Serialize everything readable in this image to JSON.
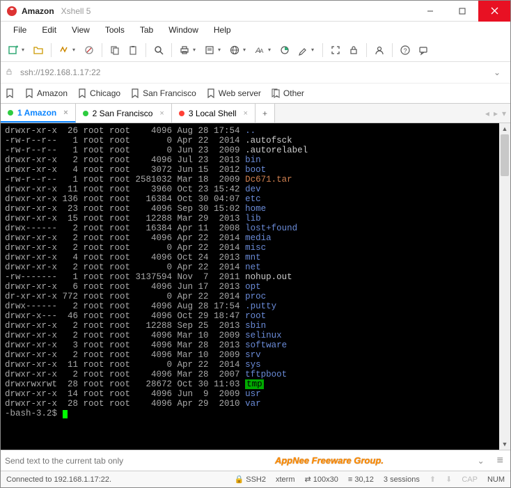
{
  "window": {
    "title": "Amazon",
    "subtitle": "Xshell 5"
  },
  "menu": [
    "File",
    "Edit",
    "View",
    "Tools",
    "Tab",
    "Window",
    "Help"
  ],
  "address": "ssh://192.168.1.17:22",
  "bookmarks": [
    {
      "label": "Amazon"
    },
    {
      "label": "Chicago"
    },
    {
      "label": "San Francisco"
    },
    {
      "label": "Web server"
    },
    {
      "label": "Other",
      "multi": true
    }
  ],
  "tabs": [
    {
      "label": "1 Amazon",
      "dot": "#2ecc40",
      "active": true
    },
    {
      "label": "2 San Francisco",
      "dot": "#2ecc40"
    },
    {
      "label": "3 Local Shell",
      "dot": "#ff4136"
    }
  ],
  "send_placeholder": "Send text to the current tab only",
  "watermark": "AppNee Freeware Group.",
  "status": {
    "conn": "Connected to 192.168.1.17:22.",
    "proto": "SSH2",
    "term": "xterm",
    "size": "100x30",
    "cursor": "30,12",
    "sessions": "3 sessions",
    "cap": "CAP",
    "num": "NUM"
  },
  "listing": [
    {
      "perm": "drwxr-xr-x",
      "n": "26",
      "o": "root",
      "g": "root",
      "size": "4096",
      "d": "Aug 28 17:54",
      "name": "..",
      "cls": "c-blue"
    },
    {
      "perm": "-rw-r--r--",
      "n": "1",
      "o": "root",
      "g": "root",
      "size": "0",
      "d": "Apr 22  2014",
      "name": ".autofsck",
      "cls": "c-white"
    },
    {
      "perm": "-rw-r--r--",
      "n": "1",
      "o": "root",
      "g": "root",
      "size": "0",
      "d": "Jun 23  2009",
      "name": ".autorelabel",
      "cls": "c-white"
    },
    {
      "perm": "drwxr-xr-x",
      "n": "2",
      "o": "root",
      "g": "root",
      "size": "4096",
      "d": "Jul 23  2013",
      "name": "bin",
      "cls": "c-blue"
    },
    {
      "perm": "drwxr-xr-x",
      "n": "4",
      "o": "root",
      "g": "root",
      "size": "3072",
      "d": "Jun 15  2012",
      "name": "boot",
      "cls": "c-blue"
    },
    {
      "perm": "-rw-r--r--",
      "n": "1",
      "o": "root",
      "g": "root",
      "size": "2581032",
      "d": "Mar 18  2009",
      "name": "Dc671.tar",
      "cls": "c-red"
    },
    {
      "perm": "drwxr-xr-x",
      "n": "11",
      "o": "root",
      "g": "root",
      "size": "3960",
      "d": "Oct 23 15:42",
      "name": "dev",
      "cls": "c-blue"
    },
    {
      "perm": "drwxr-xr-x",
      "n": "136",
      "o": "root",
      "g": "root",
      "size": "16384",
      "d": "Oct 30 04:07",
      "name": "etc",
      "cls": "c-blue"
    },
    {
      "perm": "drwxr-xr-x",
      "n": "23",
      "o": "root",
      "g": "root",
      "size": "4096",
      "d": "Sep 30 15:02",
      "name": "home",
      "cls": "c-blue"
    },
    {
      "perm": "drwxr-xr-x",
      "n": "15",
      "o": "root",
      "g": "root",
      "size": "12288",
      "d": "Mar 29  2013",
      "name": "lib",
      "cls": "c-blue"
    },
    {
      "perm": "drwx------",
      "n": "2",
      "o": "root",
      "g": "root",
      "size": "16384",
      "d": "Apr 11  2008",
      "name": "lost+found",
      "cls": "c-blue"
    },
    {
      "perm": "drwxr-xr-x",
      "n": "2",
      "o": "root",
      "g": "root",
      "size": "4096",
      "d": "Apr 22  2014",
      "name": "media",
      "cls": "c-blue"
    },
    {
      "perm": "drwxr-xr-x",
      "n": "2",
      "o": "root",
      "g": "root",
      "size": "0",
      "d": "Apr 22  2014",
      "name": "misc",
      "cls": "c-blue"
    },
    {
      "perm": "drwxr-xr-x",
      "n": "4",
      "o": "root",
      "g": "root",
      "size": "4096",
      "d": "Oct 24  2013",
      "name": "mnt",
      "cls": "c-blue"
    },
    {
      "perm": "drwxr-xr-x",
      "n": "2",
      "o": "root",
      "g": "root",
      "size": "0",
      "d": "Apr 22  2014",
      "name": "net",
      "cls": "c-blue"
    },
    {
      "perm": "-rw-------",
      "n": "1",
      "o": "root",
      "g": "root",
      "size": "3137594",
      "d": "Nov  7  2011",
      "name": "nohup.out",
      "cls": "c-white"
    },
    {
      "perm": "drwxr-xr-x",
      "n": "6",
      "o": "root",
      "g": "root",
      "size": "4096",
      "d": "Jun 17  2013",
      "name": "opt",
      "cls": "c-blue"
    },
    {
      "perm": "dr-xr-xr-x",
      "n": "772",
      "o": "root",
      "g": "root",
      "size": "0",
      "d": "Apr 22  2014",
      "name": "proc",
      "cls": "c-blue"
    },
    {
      "perm": "drwx------",
      "n": "2",
      "o": "root",
      "g": "root",
      "size": "4096",
      "d": "Aug 28 17:54",
      "name": ".putty",
      "cls": "c-blue"
    },
    {
      "perm": "drwxr-x---",
      "n": "46",
      "o": "root",
      "g": "root",
      "size": "4096",
      "d": "Oct 29 18:47",
      "name": "root",
      "cls": "c-blue"
    },
    {
      "perm": "drwxr-xr-x",
      "n": "2",
      "o": "root",
      "g": "root",
      "size": "12288",
      "d": "Sep 25  2013",
      "name": "sbin",
      "cls": "c-blue"
    },
    {
      "perm": "drwxr-xr-x",
      "n": "2",
      "o": "root",
      "g": "root",
      "size": "4096",
      "d": "Mar 10  2009",
      "name": "selinux",
      "cls": "c-blue"
    },
    {
      "perm": "drwxr-xr-x",
      "n": "3",
      "o": "root",
      "g": "root",
      "size": "4096",
      "d": "Mar 28  2013",
      "name": "software",
      "cls": "c-blue"
    },
    {
      "perm": "drwxr-xr-x",
      "n": "2",
      "o": "root",
      "g": "root",
      "size": "4096",
      "d": "Mar 10  2009",
      "name": "srv",
      "cls": "c-blue"
    },
    {
      "perm": "drwxr-xr-x",
      "n": "11",
      "o": "root",
      "g": "root",
      "size": "0",
      "d": "Apr 22  2014",
      "name": "sys",
      "cls": "c-blue"
    },
    {
      "perm": "drwxr-xr-x",
      "n": "2",
      "o": "root",
      "g": "root",
      "size": "4096",
      "d": "Mar 28  2007",
      "name": "tftpboot",
      "cls": "c-blue"
    },
    {
      "perm": "drwxrwxrwt",
      "n": "28",
      "o": "root",
      "g": "root",
      "size": "28672",
      "d": "Oct 30 11:03",
      "name": "tmp",
      "cls": "c-bg-green"
    },
    {
      "perm": "drwxr-xr-x",
      "n": "14",
      "o": "root",
      "g": "root",
      "size": "4096",
      "d": "Jun  9  2009",
      "name": "usr",
      "cls": "c-blue"
    },
    {
      "perm": "drwxr-xr-x",
      "n": "28",
      "o": "root",
      "g": "root",
      "size": "4096",
      "d": "Apr 29  2010",
      "name": "var",
      "cls": "c-blue"
    }
  ],
  "prompt": "-bash-3.2$ "
}
